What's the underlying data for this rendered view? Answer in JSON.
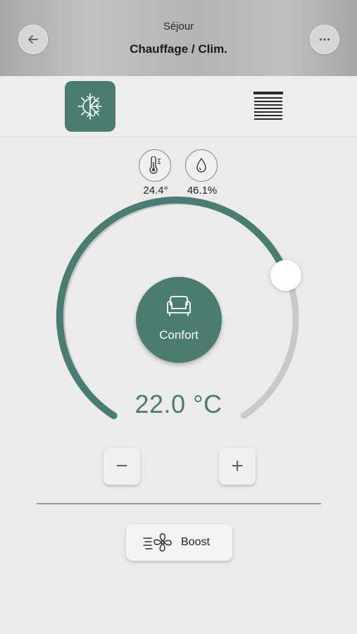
{
  "header": {
    "room": "Séjour",
    "title": "Chauffage / Clim.",
    "back_icon": "arrow-left-icon",
    "menu_icon": "more-horizontal-icon"
  },
  "tabs": [
    {
      "name": "climate",
      "icon": "sun-snowflake-icon",
      "active": true
    },
    {
      "name": "blinds",
      "icon": "blind-icon",
      "active": false
    }
  ],
  "sensors": {
    "temperature": {
      "icon": "thermometer-icon",
      "value": "24.4°"
    },
    "humidity": {
      "icon": "droplet-icon",
      "value": "46.1%"
    }
  },
  "dial": {
    "mode_label": "Confort",
    "mode_icon": "armchair-icon",
    "setpoint": "22.0 °C",
    "level_fraction": 0.66
  },
  "controls": {
    "minus_label": "−",
    "plus_label": "+",
    "boost_label": "Boost",
    "boost_icon": "fan-icon"
  },
  "colors": {
    "accent": "#4a7c72",
    "track": "#c9c9c9",
    "background": "#ebebeb"
  }
}
